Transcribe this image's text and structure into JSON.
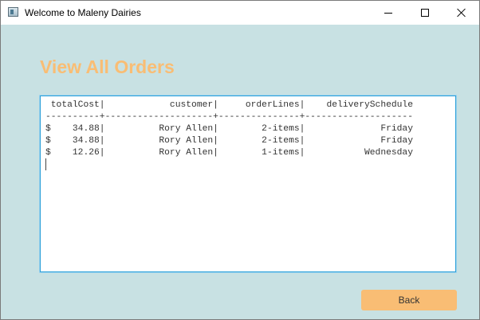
{
  "window": {
    "title": "Welcome to Maleny Dairies"
  },
  "page": {
    "title": "View All Orders"
  },
  "orders_table": {
    "columns": [
      "totalCost",
      "customer",
      "orderLines",
      "deliverySchedule"
    ],
    "rows": [
      {
        "totalCost": "$    34.88",
        "customer": "Rory Allen",
        "orderLines": "2-items",
        "deliverySchedule": "Friday"
      },
      {
        "totalCost": "$    34.88",
        "customer": "Rory Allen",
        "orderLines": "2-items",
        "deliverySchedule": "Friday"
      },
      {
        "totalCost": "$    12.26",
        "customer": "Rory Allen",
        "orderLines": "1-items",
        "deliverySchedule": "Wednesday"
      }
    ],
    "text": " totalCost|            customer|     orderLines|    deliverySchedule\n----------+--------------------+---------------+--------------------\n$    34.88|          Rory Allen|        2-items|              Friday\n$    34.88|          Rory Allen|        2-items|              Friday\n$    12.26|          Rory Allen|        1-items|           Wednesday"
  },
  "buttons": {
    "back_label": "Back"
  },
  "colors": {
    "background": "#c8e1e3",
    "accent": "#f9bd74",
    "focus_border": "#2a9fd8"
  }
}
